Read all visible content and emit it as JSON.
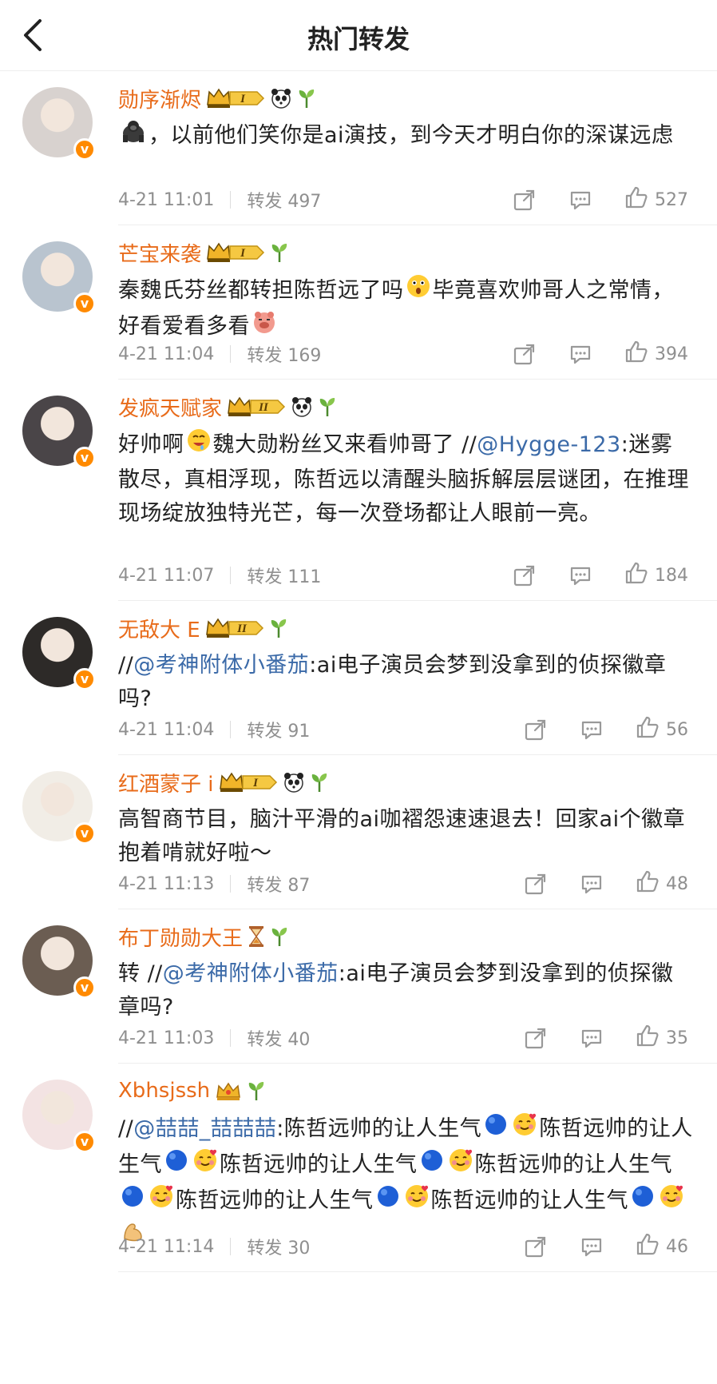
{
  "header": {
    "title": "热门转发"
  },
  "items": [
    {
      "name": "勋序渐烬",
      "level": "I",
      "segments": [
        {
          "t": "text",
          "v": "，以前他们笑你是ai演技，到今天才明白你的深谋远虑"
        }
      ],
      "time": "4-21 11:01",
      "repost_label": "转发 497",
      "likes": "527",
      "extra_icons": [
        "panda",
        "sprout"
      ],
      "lead_icon": "gorilla"
    },
    {
      "name": "芒宝来袭",
      "level": "I",
      "segments": [
        {
          "t": "text",
          "v": "秦魏氏芬丝都转担陈哲远了吗"
        },
        {
          "t": "emoji",
          "v": "shock"
        },
        {
          "t": "text",
          "v": "毕竟喜欢帅哥人之常情，好看爱看多看"
        },
        {
          "t": "emoji",
          "v": "pig"
        }
      ],
      "time": "4-21 11:04",
      "repost_label": "转发 169",
      "likes": "394",
      "extra_icons": [
        "sprout"
      ]
    },
    {
      "name": "发疯天赋家",
      "level": "II",
      "segments": [
        {
          "t": "text",
          "v": "好帅啊"
        },
        {
          "t": "emoji",
          "v": "drool"
        },
        {
          "t": "text",
          "v": "魏大勋粉丝又来看帅哥了 //"
        },
        {
          "t": "at",
          "v": "@Hygge-123"
        },
        {
          "t": "text",
          "v": ":迷雾散尽，真相浮现，陈哲远以清醒头脑拆解层层谜团，在推理现场绽放独特光芒，每一次登场都让人眼前一亮。"
        }
      ],
      "time": "4-21 11:07",
      "repost_label": "转发 111",
      "likes": "184",
      "extra_icons": [
        "panda",
        "sprout"
      ]
    },
    {
      "name": "无敌大 E",
      "level": "II",
      "segments": [
        {
          "t": "text",
          "v": "//"
        },
        {
          "t": "at",
          "v": "@考神附体小番茄"
        },
        {
          "t": "text",
          "v": ":ai电子演员会梦到没拿到的侦探徽章吗?"
        }
      ],
      "time": "4-21 11:04",
      "repost_label": "转发 91",
      "likes": "56",
      "extra_icons": [
        "sprout"
      ]
    },
    {
      "name": "红酒蒙子 i",
      "level": "I",
      "segments": [
        {
          "t": "text",
          "v": "高智商节目，脑汁平滑的ai咖褶怨速速退去！回家ai个徽章抱着啃就好啦～"
        }
      ],
      "time": "4-21 11:13",
      "repost_label": "转发 87",
      "likes": "48",
      "extra_icons": [
        "panda",
        "sprout"
      ]
    },
    {
      "name": "布丁勋勋大王",
      "level": "",
      "segments": [
        {
          "t": "text",
          "v": "转 //"
        },
        {
          "t": "at",
          "v": "@考神附体小番茄"
        },
        {
          "t": "text",
          "v": ":ai电子演员会梦到没拿到的侦探徽章吗?"
        }
      ],
      "time": "4-21 11:03",
      "repost_label": "转发 40",
      "likes": "35",
      "extra_icons": [
        "hourglass",
        "sprout"
      ]
    },
    {
      "name": "Xbhsjssh",
      "level": "",
      "segments": [
        {
          "t": "text",
          "v": "//"
        },
        {
          "t": "at",
          "v": "@喆喆_喆喆喆"
        },
        {
          "t": "text",
          "v": ":陈哲远帅的让人生气"
        },
        {
          "t": "emoji",
          "v": "blue"
        },
        {
          "t": "emoji",
          "v": "love"
        },
        {
          "t": "text",
          "v": "陈哲远帅的让人生气"
        },
        {
          "t": "emoji",
          "v": "blue"
        },
        {
          "t": "emoji",
          "v": "love"
        },
        {
          "t": "text",
          "v": "陈哲远帅的让人生气"
        },
        {
          "t": "emoji",
          "v": "blue"
        },
        {
          "t": "emoji",
          "v": "love"
        },
        {
          "t": "text",
          "v": "陈哲远帅的让人生气"
        },
        {
          "t": "emoji",
          "v": "blue"
        },
        {
          "t": "emoji",
          "v": "love"
        },
        {
          "t": "text",
          "v": "陈哲远帅的让人生气"
        },
        {
          "t": "emoji",
          "v": "blue"
        },
        {
          "t": "emoji",
          "v": "love"
        },
        {
          "t": "text",
          "v": "陈哲远帅的让人生气"
        },
        {
          "t": "emoji",
          "v": "blue"
        },
        {
          "t": "emoji",
          "v": "love"
        },
        {
          "t": "emoji",
          "v": "muscle"
        }
      ],
      "time": "4-21 11:14",
      "repost_label": "转发 30",
      "likes": "46",
      "extra_icons": [
        "crown-small",
        "sprout"
      ]
    }
  ],
  "colors": {
    "accent_name": "#e86b1a",
    "link": "#3b6aa8",
    "muted": "#8f8f8f",
    "badge": "#ff8a00"
  }
}
